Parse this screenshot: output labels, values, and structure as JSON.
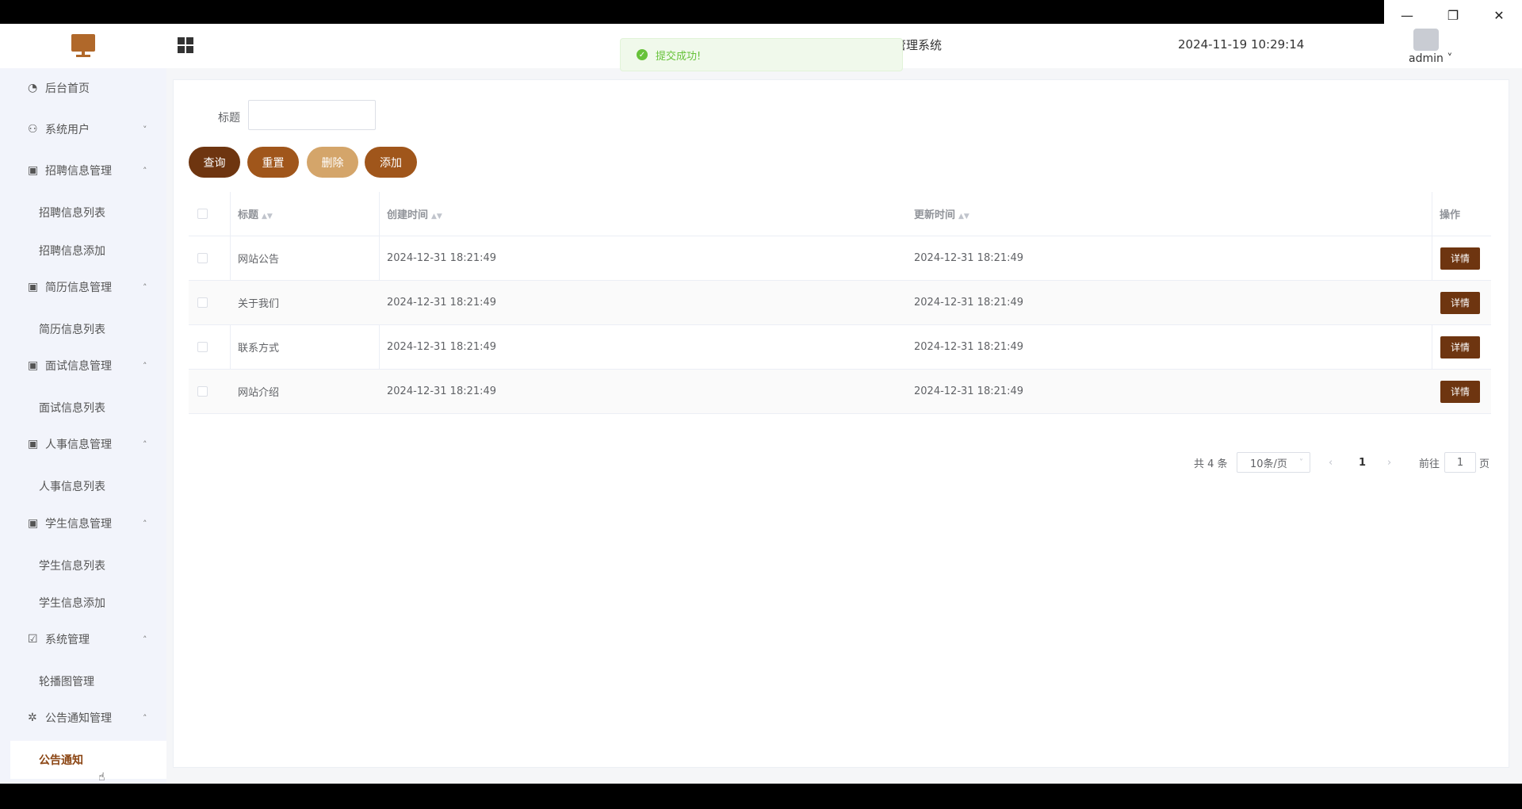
{
  "window": {
    "minimize": "—",
    "maximize": "❐",
    "close": "✕"
  },
  "header": {
    "system_title": "管理系统",
    "datetime": "2024-11-19 10:29:14",
    "username": "admin ˅"
  },
  "toast": {
    "message": "提交成功!"
  },
  "sidebar": {
    "groups": [
      {
        "icon": "◔",
        "label": "后台首页",
        "arrow": ""
      },
      {
        "icon": "⚇",
        "label": "系统用户",
        "arrow": "˅"
      },
      {
        "icon": "▣",
        "label": "招聘信息管理",
        "arrow": "˄"
      },
      {
        "icon": "▣",
        "label": "简历信息管理",
        "arrow": "˄"
      },
      {
        "icon": "▣",
        "label": "面试信息管理",
        "arrow": "˄"
      },
      {
        "icon": "▣",
        "label": "人事信息管理",
        "arrow": "˄"
      },
      {
        "icon": "▣",
        "label": "学生信息管理",
        "arrow": "˄"
      },
      {
        "icon": "☑",
        "label": "系统管理",
        "arrow": "˄"
      },
      {
        "icon": "✲",
        "label": "公告通知管理",
        "arrow": "˄"
      }
    ],
    "subs": [
      "招聘信息列表",
      "招聘信息添加",
      "简历信息列表",
      "面试信息列表",
      "人事信息列表",
      "学生信息列表",
      "学生信息添加",
      "轮播图管理",
      "公告通知"
    ]
  },
  "search": {
    "label": "标题",
    "value": ""
  },
  "buttons": {
    "query": "查询",
    "reset": "重置",
    "delete": "删除",
    "add": "添加"
  },
  "table": {
    "headers": {
      "title": "标题",
      "created": "创建时间",
      "updated": "更新时间",
      "actions": "操作"
    },
    "rows": [
      {
        "title": "网站公告",
        "created": "2024-12-31 18:21:49",
        "updated": "2024-12-31 18:21:49",
        "action": "详情"
      },
      {
        "title": "关于我们",
        "created": "2024-12-31 18:21:49",
        "updated": "2024-12-31 18:21:49",
        "action": "详情"
      },
      {
        "title": "联系方式",
        "created": "2024-12-31 18:21:49",
        "updated": "2024-12-31 18:21:49",
        "action": "详情"
      },
      {
        "title": "网站介绍",
        "created": "2024-12-31 18:21:49",
        "updated": "2024-12-31 18:21:49",
        "action": "详情"
      }
    ]
  },
  "pagination": {
    "total": "共 4 条",
    "page_size": "10条/页",
    "current": "1",
    "goto_label": "前往",
    "goto_value": "1",
    "page_suffix": "页",
    "prev": "‹",
    "next": "›"
  }
}
